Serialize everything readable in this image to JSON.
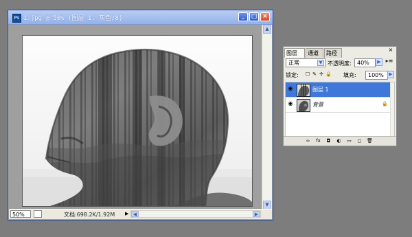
{
  "document_window": {
    "title": "1.jpg @ 50% (图层 1, 灰色/8)",
    "app_icon": "photoshop-icon",
    "controls": {
      "minimize": "_",
      "maximize": "□",
      "close": "×"
    },
    "status": {
      "zoom": "50%",
      "doc_size": "文档:698.2K/1.92M"
    }
  },
  "layers_panel": {
    "tabs": [
      {
        "label": "图层",
        "close": "×"
      },
      {
        "label": "通道"
      },
      {
        "label": "路径"
      }
    ],
    "panel_close": "×",
    "menu_icon": "▸≡",
    "blend_mode": "正常",
    "opacity_label": "不透明度:",
    "opacity_value": "40%",
    "lock_label": "锁定:",
    "fill_label": "填充:",
    "fill_value": "100%",
    "layers": [
      {
        "name": "图层 1",
        "selected": true
      },
      {
        "name": "背景",
        "selected": false,
        "locked": true
      }
    ],
    "bottom_icons": [
      "link-icon",
      "fx-icon",
      "mask-icon",
      "adjustment-icon",
      "folder-icon",
      "new-layer-icon",
      "trash-icon"
    ]
  }
}
